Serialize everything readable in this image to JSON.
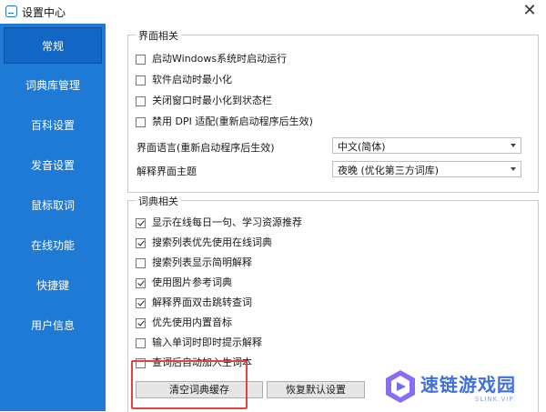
{
  "window": {
    "title": "设置中心",
    "close": "✕"
  },
  "sidebar": {
    "items": [
      {
        "label": "常规",
        "active": true
      },
      {
        "label": "词典库管理"
      },
      {
        "label": "百科设置"
      },
      {
        "label": "发音设置"
      },
      {
        "label": "鼠标取词"
      },
      {
        "label": "在线功能"
      },
      {
        "label": "快捷键"
      },
      {
        "label": "用户信息"
      }
    ]
  },
  "interface": {
    "title": "界面相关",
    "options": [
      {
        "label": "启动Windows系统时启动运行",
        "checked": false
      },
      {
        "label": "软件启动时最小化",
        "checked": false
      },
      {
        "label": "关闭窗口时最小化到状态栏",
        "checked": false
      },
      {
        "label": "禁用 DPI 适配(重新启动程序后生效)",
        "checked": false
      }
    ],
    "language_label": "界面语言(重新启动程序后生效)",
    "language_value": "中文(简体)",
    "theme_label": "解释界面主题",
    "theme_value": "夜晚 (优化第三方词库)"
  },
  "dictionary": {
    "title": "词典相关",
    "options": [
      {
        "label": "显示在线每日一句、学习资源推荐",
        "checked": true
      },
      {
        "label": "搜索列表优先使用在线词典",
        "checked": true
      },
      {
        "label": "搜索列表显示简明解释",
        "checked": false
      },
      {
        "label": "使用图片参考词典",
        "checked": true
      },
      {
        "label": "解释界面双击跳转查词",
        "checked": true
      },
      {
        "label": "优先使用内置音标",
        "checked": true
      },
      {
        "label": "输入单词时即时提示解释",
        "checked": false
      },
      {
        "label": "查词后自动加入生词本",
        "checked": false
      }
    ],
    "clear_cache_button": "清空词典缓存",
    "restore_default_button": "恢复默认设置"
  },
  "watermark": {
    "text": "速链游戏园",
    "sub": "SLINK.VIP"
  },
  "colors": {
    "sidebar": "#1f7ad6",
    "sidebar_active": "#1266c4",
    "highlight": "#e0443e"
  }
}
